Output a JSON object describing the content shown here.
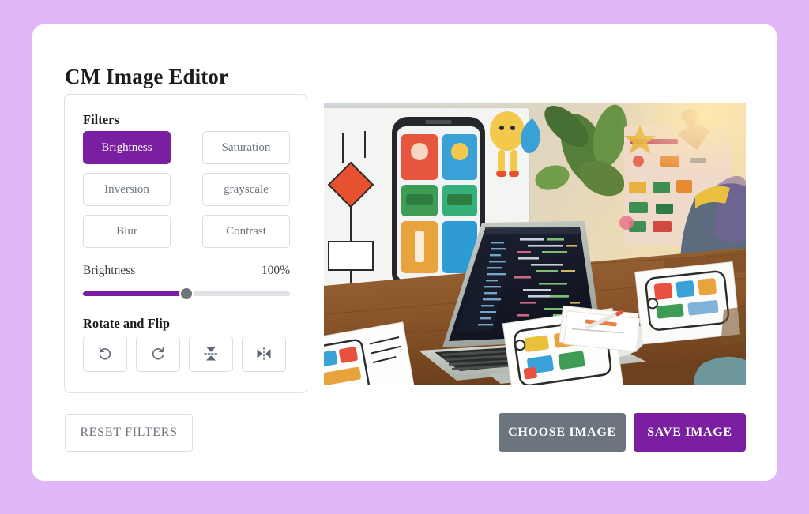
{
  "app": {
    "title": "CM Image Editor",
    "background_color": "#e0b8f8",
    "card_color": "#ffffff",
    "accent_color": "#7b1fa2",
    "muted_color": "#6c757d",
    "border_color": "#dee2e6"
  },
  "filters": {
    "heading": "Filters",
    "active_index": 0,
    "buttons": [
      {
        "label": "Brightness",
        "active": true
      },
      {
        "label": "Saturation",
        "active": false
      },
      {
        "label": "Inversion",
        "active": false
      },
      {
        "label": "grayscale",
        "active": false
      },
      {
        "label": "Blur",
        "active": false
      },
      {
        "label": "Contrast",
        "active": false
      }
    ]
  },
  "slider": {
    "name": "Brightness",
    "value_label": "100%",
    "value": 100,
    "min": 0,
    "max": 200,
    "thumb_percent": 50,
    "fill_color": "#7b1fa2",
    "track_color": "#dfe1e5",
    "thumb_color": "#6c757d"
  },
  "rotate": {
    "heading": "Rotate and Flip",
    "buttons": [
      {
        "icon": "rotate-left-icon",
        "title": "Rotate left"
      },
      {
        "icon": "rotate-right-icon",
        "title": "Rotate right"
      },
      {
        "icon": "flip-vertical-icon",
        "title": "Flip vertical"
      },
      {
        "icon": "flip-horizontal-icon",
        "title": "Flip horizontal"
      }
    ]
  },
  "preview": {
    "alt": "Workspace photo: laptop with code editor, monitor with mobile UI mockups, paper wireframe sketches on a wooden desk, plants and a person at a sticky-note board"
  },
  "footer": {
    "reset_label": "RESET FILTERS",
    "choose_label": "CHOOSE IMAGE",
    "save_label": "SAVE IMAGE"
  }
}
